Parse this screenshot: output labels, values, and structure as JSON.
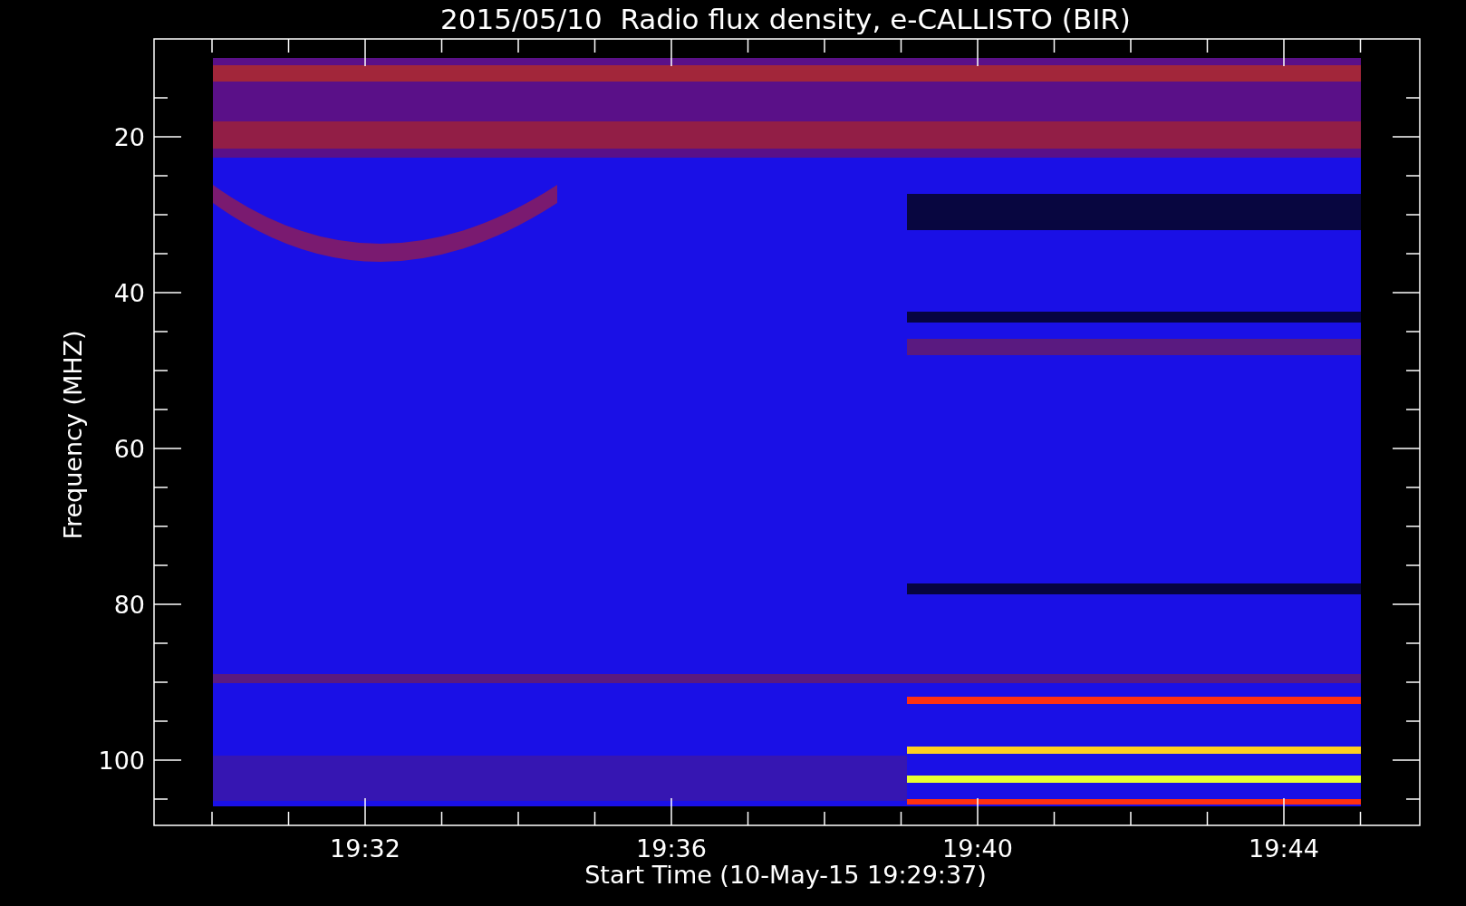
{
  "title": "2015/05/10  Radio flux density, e-CALLISTO (BIR)",
  "y_axis": {
    "label": "Frequency (MHZ)",
    "ticks": [
      "20",
      "40",
      "60",
      "80",
      "100"
    ]
  },
  "x_axis": {
    "label": "Start Time (10-May-15 19:29:37)",
    "ticks": [
      "19:32",
      "19:36",
      "19:40",
      "19:44"
    ]
  }
}
